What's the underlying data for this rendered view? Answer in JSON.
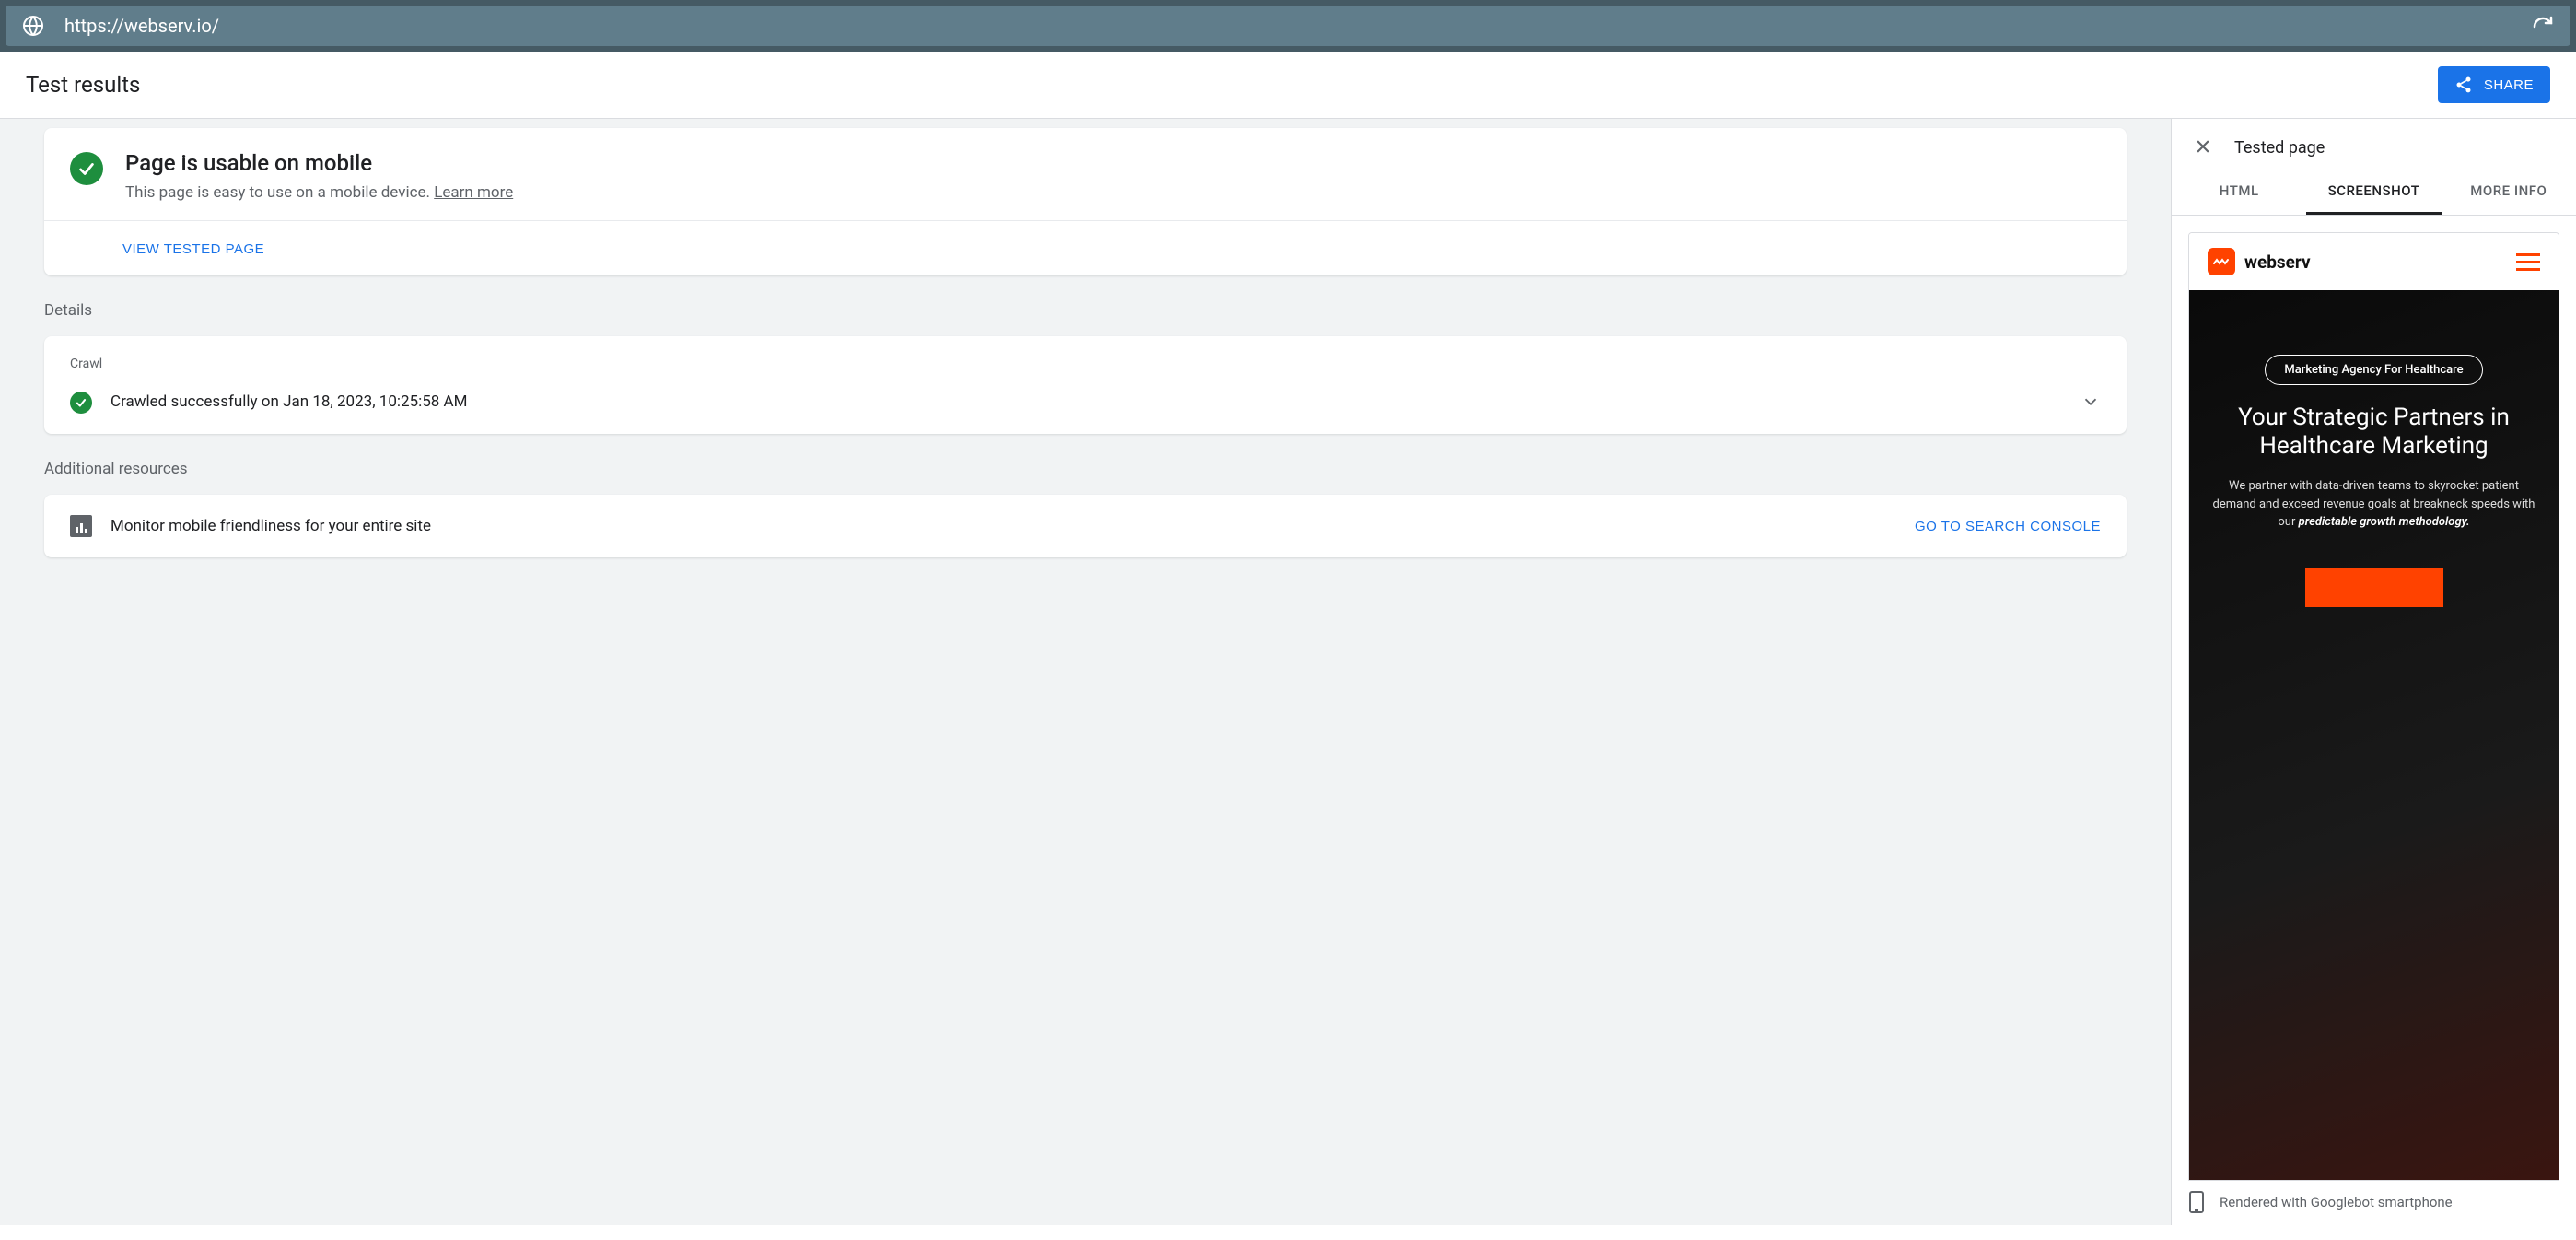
{
  "url": "https://webserv.io/",
  "header": {
    "title": "Test results",
    "share_label": "SHARE"
  },
  "status": {
    "heading": "Page is usable on mobile",
    "subtext": "This page is easy to use on a mobile device. ",
    "learn_more": "Learn more",
    "view_tested_label": "VIEW TESTED PAGE"
  },
  "details": {
    "section_label": "Details",
    "crawl_label": "Crawl",
    "crawl_status": "Crawled successfully on Jan 18, 2023, 10:25:58 AM"
  },
  "resources": {
    "section_label": "Additional resources",
    "monitor_text": "Monitor mobile friendliness for your entire site",
    "console_label": "GO TO SEARCH CONSOLE"
  },
  "side": {
    "title": "Tested page",
    "tabs": {
      "html": "HTML",
      "screenshot": "SCREENSHOT",
      "more": "MORE INFO"
    },
    "render_note": "Rendered with Googlebot smartphone"
  },
  "preview": {
    "brand": "webserv",
    "pill": "Marketing Agency For Healthcare",
    "hero_line1": "Your Strategic Partners in",
    "hero_line2": "Healthcare Marketing",
    "hero_p_pre": "We partner with data-driven teams to skyrocket patient demand and exceed revenue goals at breakneck speeds with our ",
    "hero_p_em": "predictable growth methodology."
  }
}
